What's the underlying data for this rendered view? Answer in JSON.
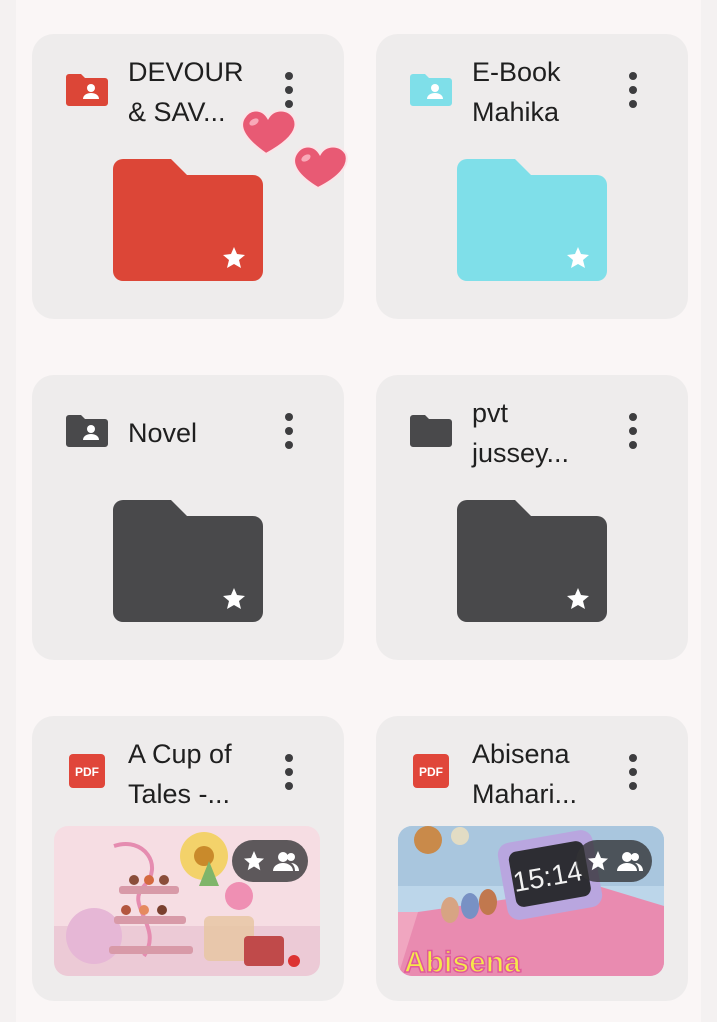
{
  "colors": {
    "red_folder": "#dc4637",
    "cyan_folder": "#7fdfe9",
    "dark_folder": "#49494b",
    "pdf_red": "#e0463a",
    "heart": "#e85a74"
  },
  "items": [
    {
      "title": "DEVOUR\n& SAV...",
      "type": "shared-folder",
      "color": "red",
      "starred": true
    },
    {
      "title": "E-Book\nMahika",
      "type": "shared-folder",
      "color": "cyan",
      "starred": true
    },
    {
      "title": "Novel",
      "type": "shared-folder",
      "color": "dark",
      "starred": true
    },
    {
      "title": "pvt\njussey...",
      "type": "folder",
      "color": "dark",
      "starred": true
    },
    {
      "title": "A Cup of\nTales -...",
      "type": "pdf",
      "pdf_label": "PDF",
      "starred": true,
      "shared": true
    },
    {
      "title": "Abisena\nMahari...",
      "type": "pdf",
      "pdf_label": "PDF",
      "starred": true,
      "shared": true,
      "thumb_clock": "15:14",
      "thumb_text": "Abisena"
    }
  ]
}
